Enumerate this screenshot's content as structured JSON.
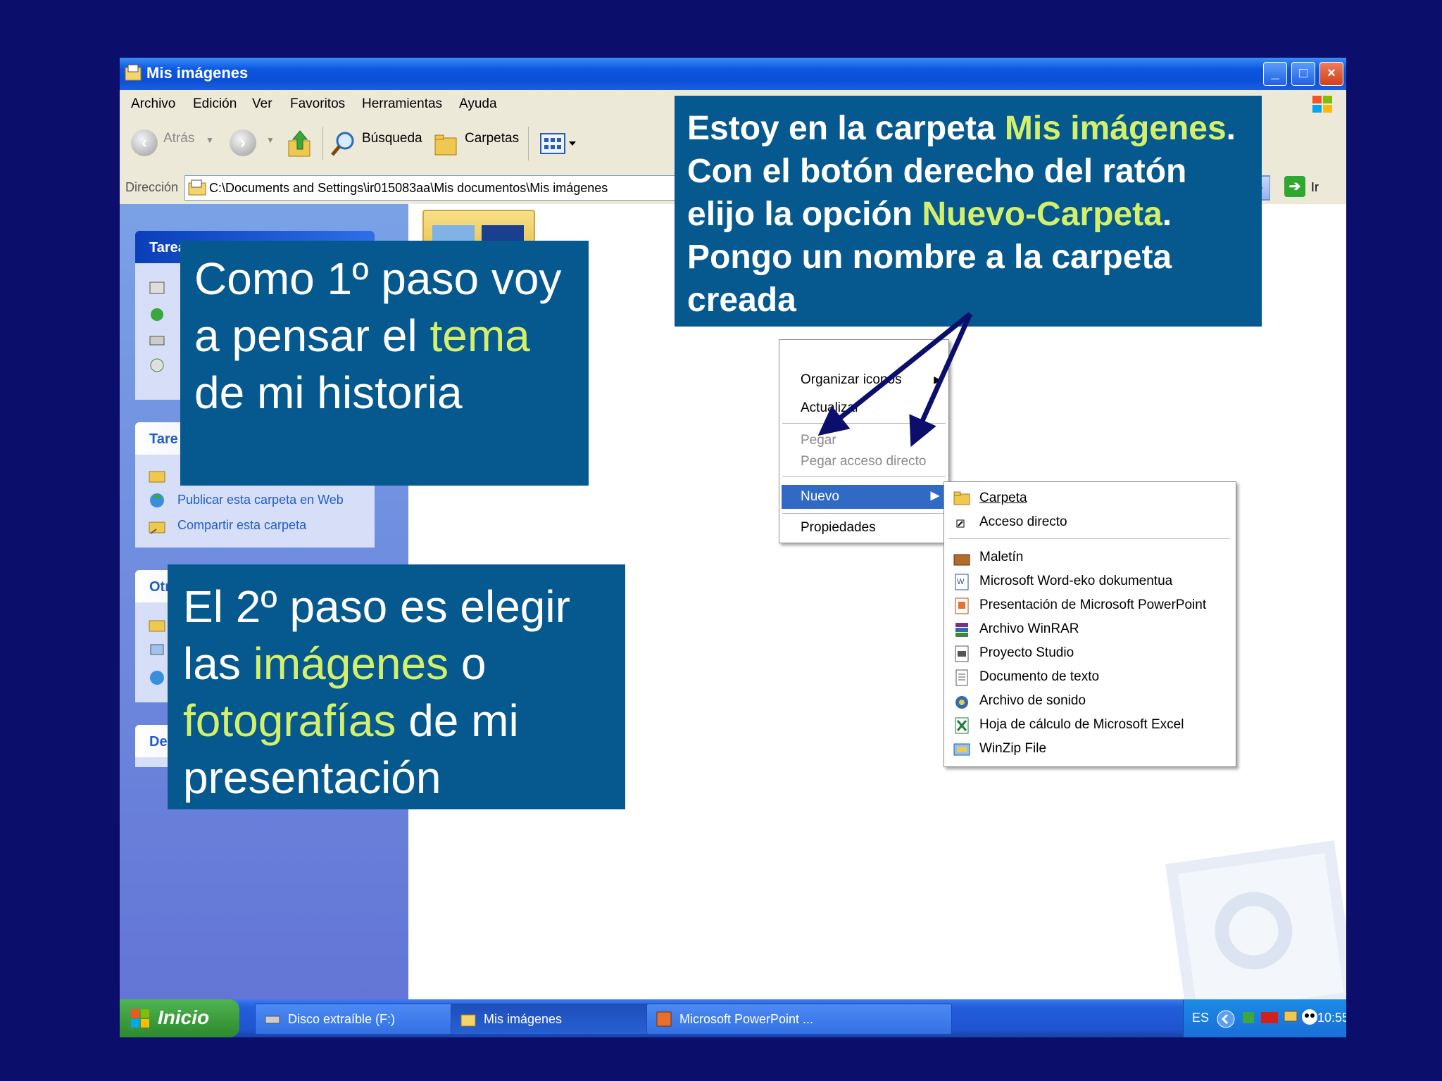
{
  "window": {
    "title": "Mis imágenes",
    "controls": {
      "minimize": "_",
      "maximize": "□",
      "close": "×"
    }
  },
  "menu": [
    "Archivo",
    "Edición",
    "Ver",
    "Favoritos",
    "Herramientas",
    "Ayuda"
  ],
  "toolbar": {
    "back": "Atrás",
    "search": "Búsqueda",
    "folders": "Carpetas"
  },
  "address": {
    "label": "Dirección",
    "path": "C:\\Documents and Settings\\ir015083aa\\Mis documentos\\Mis imágenes",
    "go": "Ir"
  },
  "taskpane": {
    "panel1_title": "Tareas de imágenes",
    "panel2_title": "Tare",
    "panel2_links": [
      "Publicar esta carpeta en Web",
      "Compartir esta carpeta"
    ],
    "panel3_title": "Otr",
    "panel4_title": "De"
  },
  "context_menu": {
    "items": [
      "Organizar iconos",
      "Actualizar",
      "Pegar",
      "Pegar acceso directo",
      "Nuevo",
      "Propiedades"
    ]
  },
  "submenu_new": {
    "items": [
      {
        "label": "Carpeta",
        "icon": "folder-icon"
      },
      {
        "label": "Acceso directo",
        "icon": "shortcut-icon"
      },
      {
        "label": "Maletín",
        "icon": "briefcase-icon"
      },
      {
        "label": "Microsoft Word-eko dokumentua",
        "icon": "word-document-icon"
      },
      {
        "label": "Presentación de Microsoft PowerPoint",
        "icon": "powerpoint-icon"
      },
      {
        "label": "Archivo WinRAR",
        "icon": "winrar-icon"
      },
      {
        "label": "Proyecto Studio",
        "icon": "studio-project-icon"
      },
      {
        "label": "Documento de texto",
        "icon": "text-document-icon"
      },
      {
        "label": "Archivo de sonido",
        "icon": "sound-file-icon"
      },
      {
        "label": "Hoja de cálculo de Microsoft Excel",
        "icon": "excel-icon"
      },
      {
        "label": "WinZip File",
        "icon": "winzip-icon"
      }
    ]
  },
  "taskbar": {
    "start": "Inicio",
    "buttons": [
      "Disco extraíble (F:)",
      "Mis imágenes",
      "Microsoft PowerPoint ..."
    ],
    "language": "ES",
    "clock": "10:55"
  },
  "callouts": {
    "box1": {
      "a": "Como 1º paso voy a  pensar el ",
      "hl": "tema",
      "b": " de mi historia"
    },
    "box2": {
      "a": "El 2º paso es elegir las ",
      "hl1": "imágenes",
      "b": " o ",
      "hl2": "fotografías",
      "c": " de mi presentación"
    },
    "box3": {
      "a": "Estoy en la carpeta ",
      "hl1": "Mis imágenes",
      "b": ". Con el botón derecho del ratón elijo la opción ",
      "hl2": "Nuevo-Carpeta",
      "c": ". Pongo un  nombre a la carpeta creada"
    }
  },
  "colors": {
    "slide_bg": "#0b0f6b",
    "callout_bg": "#06598f",
    "highlight": "#d4f06a",
    "arrow": "#0b0f6b"
  }
}
